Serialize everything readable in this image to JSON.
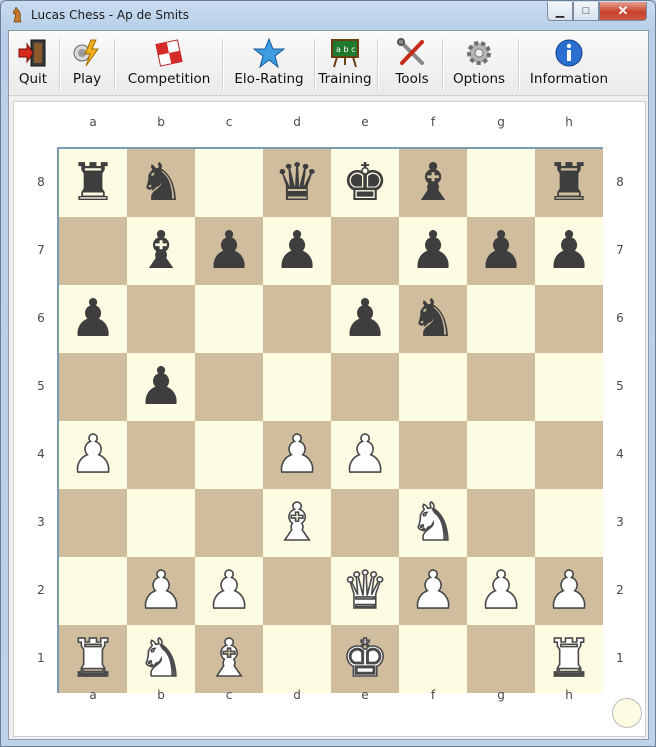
{
  "window": {
    "title": "Lucas Chess - Ap de Smits",
    "controls": {
      "minimize": "▁",
      "maximize": "□",
      "close": "✕"
    }
  },
  "toolbar": {
    "items": [
      {
        "label": "Quit",
        "icon": "quit-door-icon"
      },
      {
        "label": "Play",
        "icon": "play-lightning-icon"
      },
      {
        "label": "Competition",
        "icon": "competition-board-icon"
      },
      {
        "label": "Elo-Rating",
        "icon": "star-icon"
      },
      {
        "label": "Training",
        "icon": "blackboard-icon"
      },
      {
        "label": "Tools",
        "icon": "tools-icon"
      },
      {
        "label": "Options",
        "icon": "gear-icon"
      },
      {
        "label": "Information",
        "icon": "info-icon"
      }
    ]
  },
  "board": {
    "files": [
      "a",
      "b",
      "c",
      "d",
      "e",
      "f",
      "g",
      "h"
    ],
    "ranks": [
      "8",
      "7",
      "6",
      "5",
      "4",
      "3",
      "2",
      "1"
    ],
    "light_color": "#fdfbe1",
    "dark_color": "#cfbd9d",
    "position": [
      [
        "r",
        "n",
        "",
        "q",
        "k",
        "b",
        "",
        "r"
      ],
      [
        "",
        "b",
        "p",
        "p",
        "",
        "p",
        "p",
        "p"
      ],
      [
        "p",
        "",
        "",
        "",
        "p",
        "n",
        "",
        ""
      ],
      [
        "",
        "p",
        "",
        "",
        "",
        "",
        "",
        ""
      ],
      [
        "P",
        "",
        "",
        "P",
        "P",
        "",
        "",
        ""
      ],
      [
        "",
        "",
        "",
        "B",
        "",
        "N",
        "",
        ""
      ],
      [
        "",
        "P",
        "P",
        "",
        "Q",
        "P",
        "P",
        "P"
      ],
      [
        "R",
        "N",
        "B",
        "",
        "K",
        "",
        "",
        "R"
      ]
    ],
    "side_to_move_indicator": "white"
  }
}
